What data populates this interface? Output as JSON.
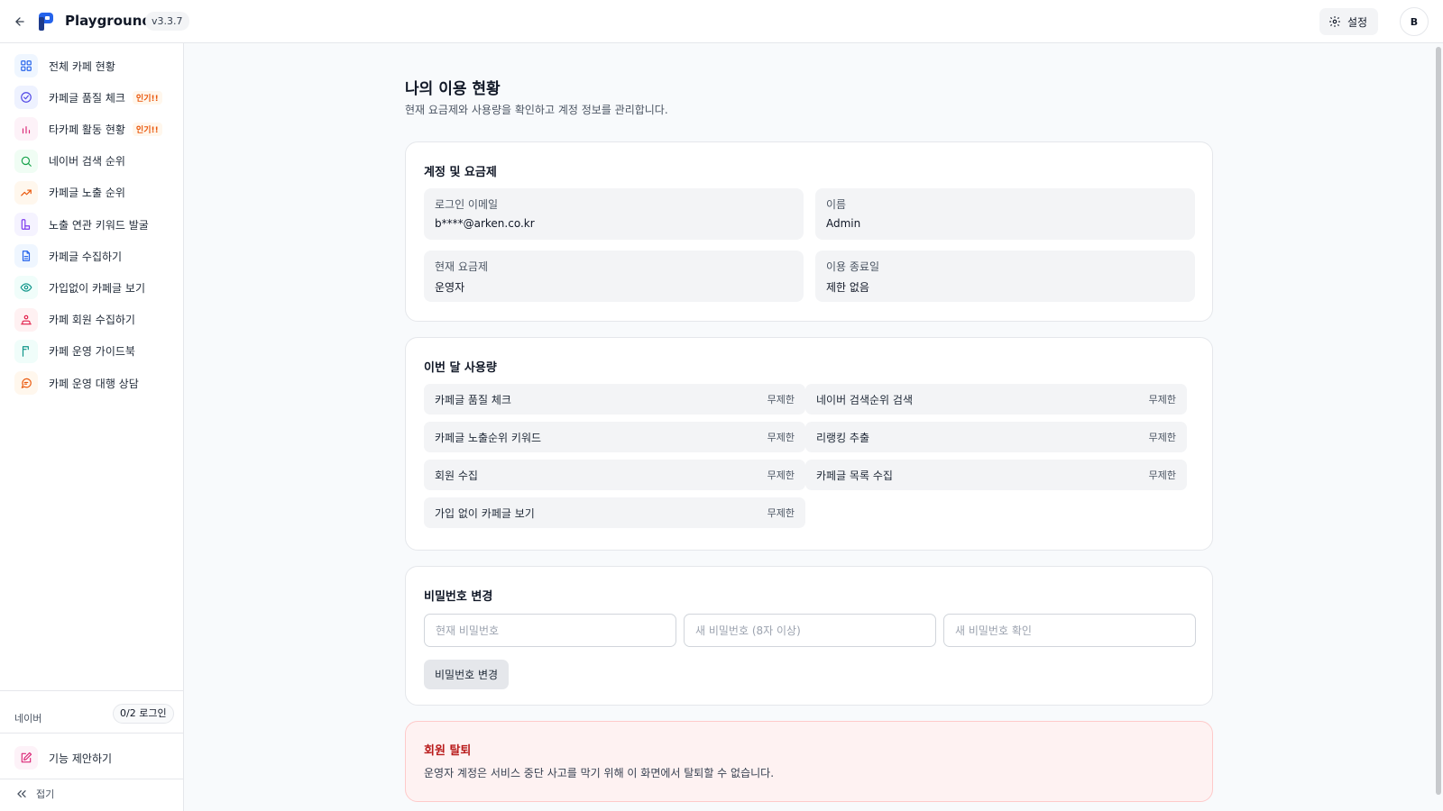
{
  "header": {
    "app_title": "Playground",
    "version": "v3.3.7",
    "settings_label": "설정",
    "avatar_initial": "B"
  },
  "sidebar": {
    "items": [
      {
        "label": "전체 카페 현황",
        "icon": "grid-icon",
        "color": "#2563eb",
        "bg": "#eff6ff"
      },
      {
        "label": "카페글 품질 체크",
        "icon": "check-circle-icon",
        "color": "#4f46e5",
        "bg": "#eef2ff",
        "badge": "인기!!"
      },
      {
        "label": "타카페 활동 현황",
        "icon": "bar-chart-icon",
        "color": "#db2777",
        "bg": "#fdf2f8",
        "badge": "인기!!"
      },
      {
        "label": "네이버 검색 순위",
        "icon": "search-icon",
        "color": "#16a34a",
        "bg": "#f0fdf4"
      },
      {
        "label": "카페글 노출 순위",
        "icon": "trending-up-icon",
        "color": "#ea580c",
        "bg": "#fff7ed"
      },
      {
        "label": "노출 연관 키워드 발굴",
        "icon": "keyword-icon",
        "color": "#7c3aed",
        "bg": "#f5f3ff"
      },
      {
        "label": "카페글 수집하기",
        "icon": "document-icon",
        "color": "#2563eb",
        "bg": "#eff6ff"
      },
      {
        "label": "가입없이 카페글 보기",
        "icon": "eye-icon",
        "color": "#0d9488",
        "bg": "#f0fdfa"
      },
      {
        "label": "카페 회원 수집하기",
        "icon": "users-icon",
        "color": "#e11d48",
        "bg": "#fff1f2"
      },
      {
        "label": "카페 운영 가이드북",
        "icon": "book-icon",
        "color": "#0d9488",
        "bg": "#f0fdfa"
      },
      {
        "label": "카페 운영 대행 상담",
        "icon": "chat-icon",
        "color": "#ea580c",
        "bg": "#fff7ed"
      }
    ],
    "naver_label": "네이버",
    "naver_login": "0/2 로그인",
    "feature_label": "기능 제안하기",
    "collapse_label": "접기"
  },
  "main": {
    "title": "나의 이용 현황",
    "subtitle": "현재 요금제와 사용량을 확인하고 계정 정보를 관리합니다.",
    "account": {
      "title": "계정 및 요금제",
      "fields": [
        {
          "label": "로그인 이메일",
          "value": "b****@arken.co.kr"
        },
        {
          "label": "이름",
          "value": "Admin"
        },
        {
          "label": "현재 요금제",
          "value": "운영자"
        },
        {
          "label": "이용 종료일",
          "value": "제한 없음"
        }
      ]
    },
    "usage": {
      "title": "이번 달 사용량",
      "rows": [
        {
          "label": "카페글 품질 체크",
          "value": "무제한"
        },
        {
          "label": "네이버 검색순위 검색",
          "value": "무제한"
        },
        {
          "label": "카페글 노출순위 키워드",
          "value": "무제한"
        },
        {
          "label": "리랭킹 추출",
          "value": "무제한"
        },
        {
          "label": "회원 수집",
          "value": "무제한"
        },
        {
          "label": "카페글 목록 수집",
          "value": "무제한"
        },
        {
          "label": "가입 없이 카페글 보기",
          "value": "무제한"
        }
      ]
    },
    "password": {
      "title": "비밀번호 변경",
      "current_placeholder": "현재 비밀번호",
      "new_placeholder": "새 비밀번호 (8자 이상)",
      "confirm_placeholder": "새 비밀번호 확인",
      "button_label": "비밀번호 변경"
    },
    "withdraw": {
      "title": "회원 탈퇴",
      "text": "운영자 계정은 서비스 중단 사고를 막기 위해 이 화면에서 탈퇴할 수 없습니다."
    }
  }
}
